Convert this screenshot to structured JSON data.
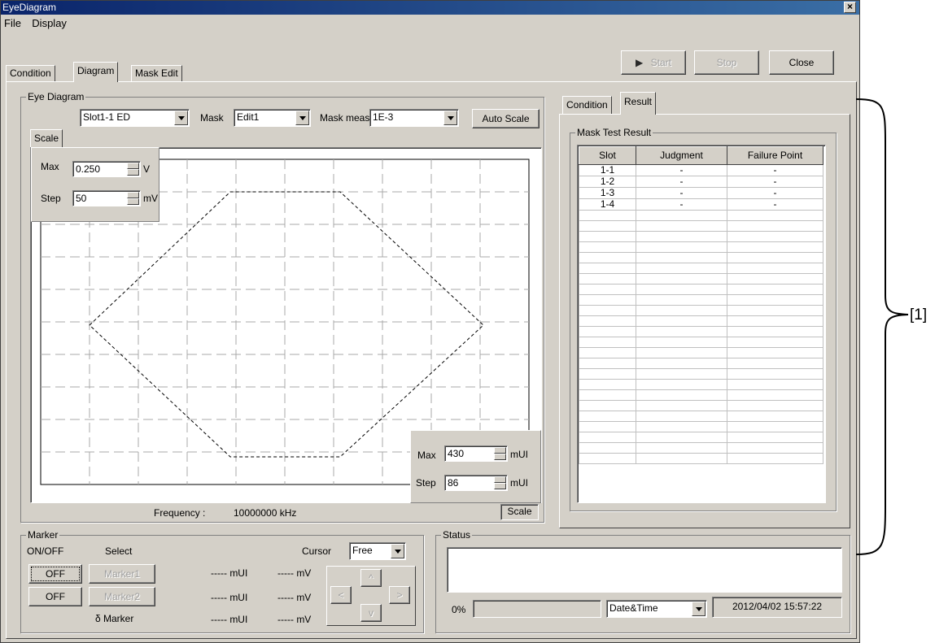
{
  "window": {
    "title": "EyeDiagram"
  },
  "menu": [
    "File",
    "Display"
  ],
  "top_tabs": [
    "Condition",
    "Diagram",
    "Mask Edit"
  ],
  "toolbar": {
    "start": "Start",
    "stop": "Stop",
    "close": "Close"
  },
  "eye_diagram": {
    "group_label": "Eye Diagram",
    "slot_select": "Slot1-1 ED",
    "mask_label": "Mask",
    "mask_select": "Edit1",
    "mask_meas_label": "Mask meas.",
    "mask_meas_select": "1E-3",
    "auto_scale": "Auto Scale",
    "scale_tab": "Scale",
    "y_max_label": "Max",
    "y_max_value": "0.250",
    "y_max_unit": "V",
    "y_step_label": "Step",
    "y_step_value": "50",
    "y_step_unit": "mV",
    "x_max_label": "Max",
    "x_max_value": "430",
    "x_max_unit": "mUI",
    "x_step_label": "Step",
    "x_step_value": "86",
    "x_step_unit": "mUI",
    "frequency_label": "Frequency :",
    "frequency_value": "10000000 kHz",
    "scale_button": "Scale"
  },
  "marker": {
    "group_label": "Marker",
    "onoff_label": "ON/OFF",
    "select_label": "Select",
    "cursor_label": "Cursor",
    "cursor_select": "Free",
    "off1": "OFF",
    "off2": "OFF",
    "marker1": "Marker1",
    "marker2": "Marker2",
    "delta_marker": "δ Marker",
    "row1_mui": "----- mUI",
    "row1_mv": "----- mV",
    "row2_mui": "----- mUI",
    "row2_mv": "----- mV",
    "row3_mui": "----- mUI",
    "row3_mv": "----- mV",
    "up": "^",
    "down": "v",
    "left": "<",
    "right": ">"
  },
  "right_panel": {
    "tabs": [
      "Condition",
      "Result"
    ],
    "group_label": "Mask Test Result",
    "columns": [
      "Slot",
      "Judgment",
      "Failure Point"
    ],
    "rows": [
      [
        "1-1",
        "-",
        "-"
      ],
      [
        "1-2",
        "-",
        "-"
      ],
      [
        "1-3",
        "-",
        "-"
      ],
      [
        "1-4",
        "-",
        "-"
      ]
    ]
  },
  "status": {
    "group_label": "Status",
    "progress_text": "0%",
    "progress_fraction": 0,
    "date_select": "Date&Time",
    "datetime": "2012/04/02 15:57:22"
  },
  "annotation": "[1]"
}
